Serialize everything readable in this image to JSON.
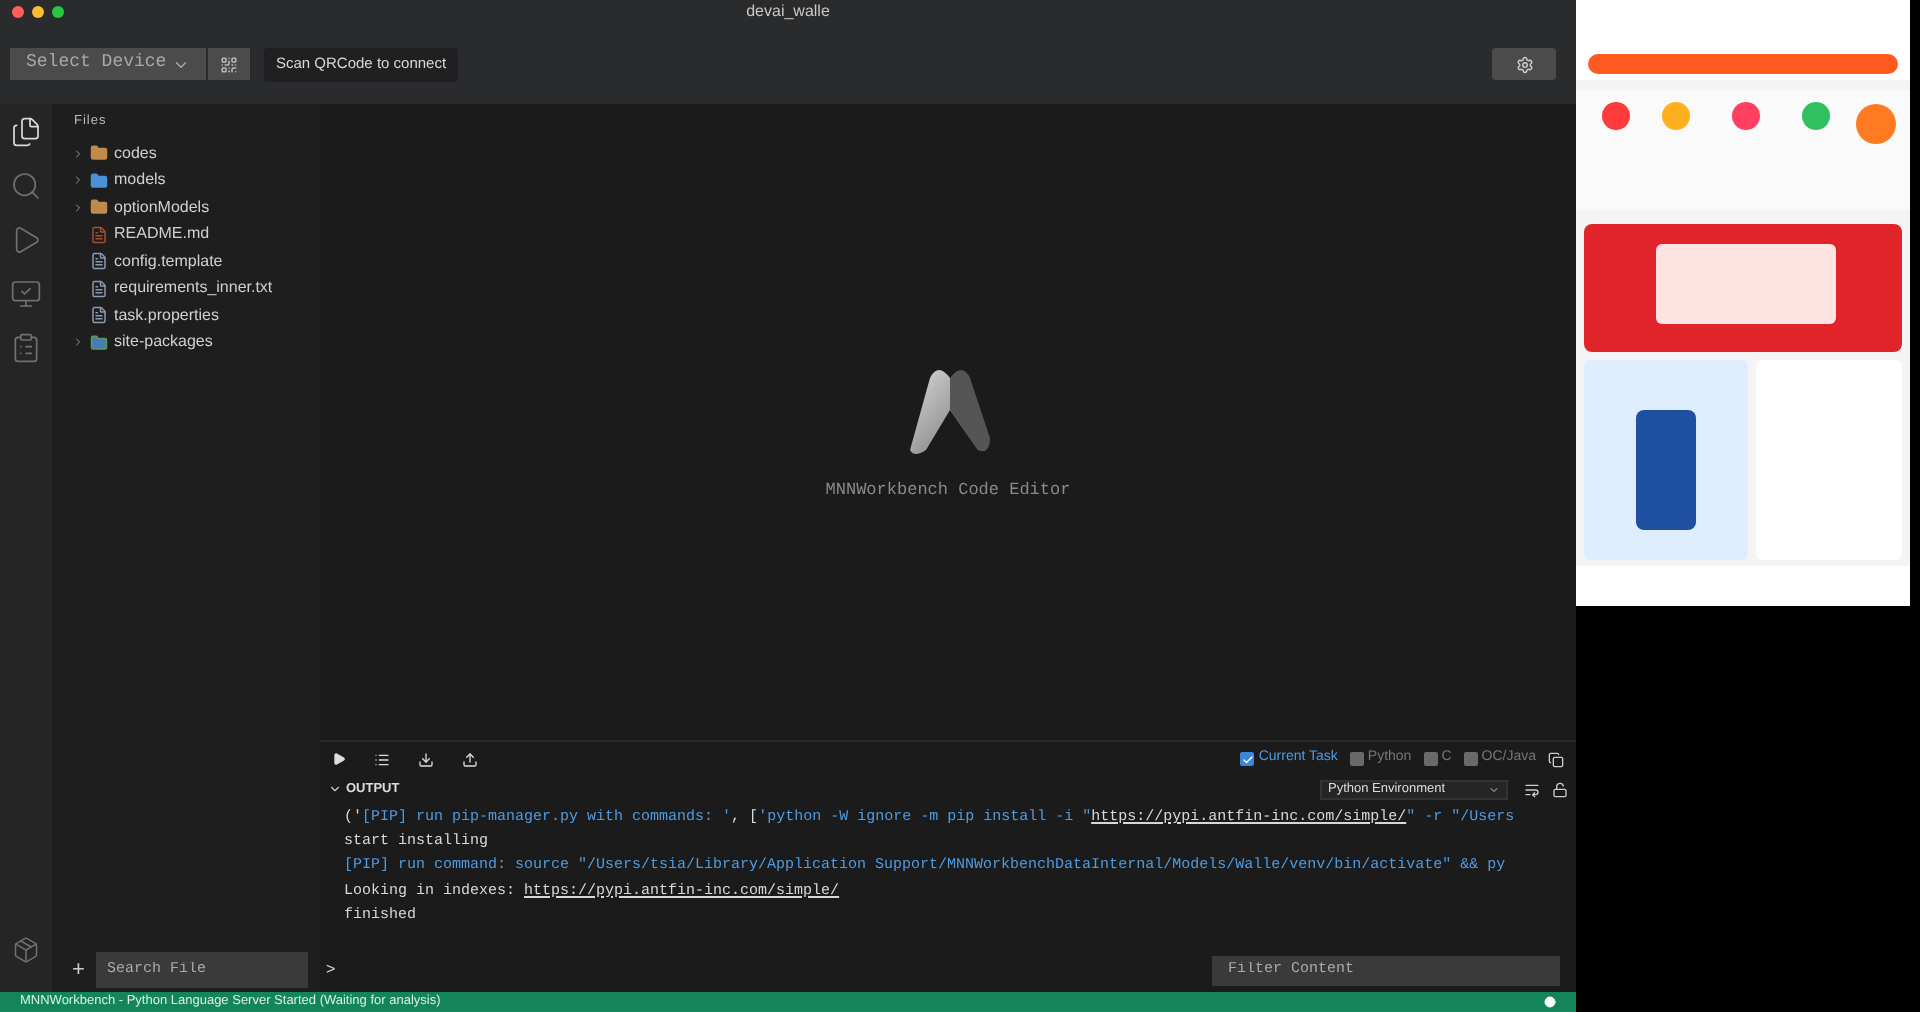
{
  "window": {
    "title": "devai_walle"
  },
  "toolbar": {
    "device_select": {
      "value": "Select Device"
    },
    "tooltip": "Scan QRCode to connect"
  },
  "explorer": {
    "title": "Files",
    "items": [
      {
        "name": "codes",
        "kind": "folder"
      },
      {
        "name": "models",
        "kind": "model-folder"
      },
      {
        "name": "optionModels",
        "kind": "folder"
      },
      {
        "name": "README.md",
        "kind": "markdown"
      },
      {
        "name": "config.template",
        "kind": "file"
      },
      {
        "name": "requirements_inner.txt",
        "kind": "file"
      },
      {
        "name": "task.properties",
        "kind": "file"
      },
      {
        "name": "site-packages",
        "kind": "package-folder"
      }
    ],
    "add_button": "+",
    "search": {
      "placeholder": "Search File"
    }
  },
  "editor": {
    "caption": "MNNWorkbench Code Editor"
  },
  "panel": {
    "filters": [
      {
        "label": "Current Task",
        "checked": true
      },
      {
        "label": "Python",
        "checked": false
      },
      {
        "label": "C",
        "checked": false
      },
      {
        "label": "OC/Java",
        "checked": false
      }
    ],
    "title": "OUTPUT",
    "environment": "Python Environment",
    "lines": [
      [
        {
          "kind": "plain",
          "text": "('"
        },
        {
          "kind": "info",
          "text": "[PIP] run pip-manager.py with commands: '"
        },
        {
          "kind": "plain",
          "text": ", ["
        },
        {
          "kind": "info",
          "text": "'python -W ignore -m pip install -i \""
        },
        {
          "kind": "link",
          "text": "https://pypi.antfin-inc.com/simple/"
        },
        {
          "kind": "info",
          "text": "\" -r \"/Users"
        }
      ],
      [
        {
          "kind": "plain",
          "text": "start installing"
        }
      ],
      [
        {
          "kind": "info",
          "text": "[PIP] run command: source \"/Users/tsia/Library/Application Support/MNNWorkbenchDataInternal/Models/Walle/venv/bin/activate\" && py"
        }
      ],
      [
        {
          "kind": "plain",
          "text": "Looking in indexes: "
        },
        {
          "kind": "link",
          "text": "https://pypi.antfin-inc.com/simple/"
        }
      ],
      [
        {
          "kind": "plain",
          "text": "finished"
        }
      ]
    ],
    "prompt": ">",
    "filter": {
      "placeholder": "Filter Content"
    }
  },
  "status_bar": {
    "text": "MNNWorkbench - Python Language Server Started (Waiting for analysis)"
  }
}
